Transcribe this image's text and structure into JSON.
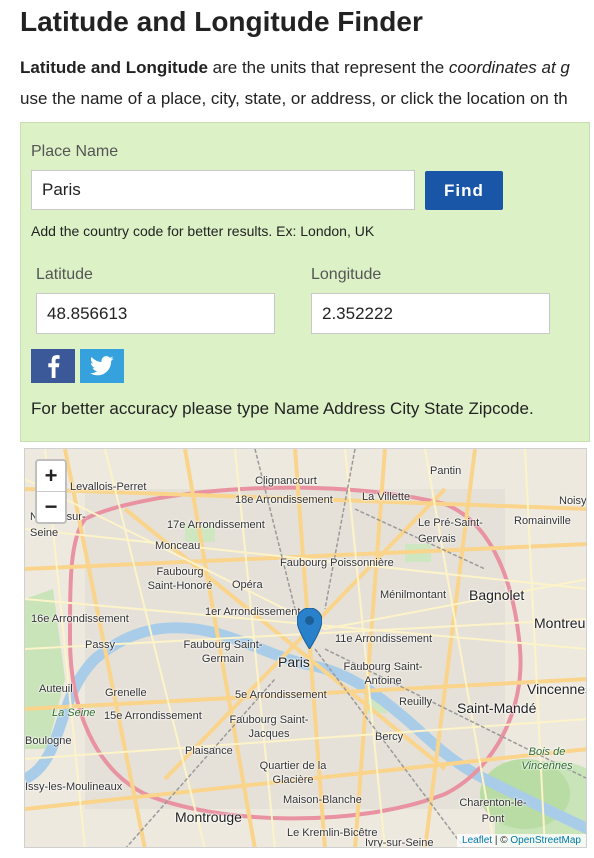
{
  "header": {
    "title": "Latitude and Longitude Finder"
  },
  "intro": {
    "line1_bold": "Latitude and Longitude",
    "line1_rest": " are the units that represent the ",
    "line1_italic": "coordinates at g",
    "line2": "use the name of a place, city, state, or address, or click the location on th"
  },
  "form": {
    "place_label": "Place Name",
    "place_value": "Paris",
    "find_label": "Find",
    "hint": "Add the country code for better results. Ex: London, UK",
    "latitude_label": "Latitude",
    "latitude_value": "48.856613",
    "longitude_label": "Longitude",
    "longitude_value": "2.352222",
    "accuracy_note": "For better accuracy please type Name Address City State Zipcode."
  },
  "social": {
    "facebook_icon": "facebook-icon",
    "twitter_icon": "twitter-icon"
  },
  "map": {
    "zoom_in": "+",
    "zoom_out": "−",
    "attribution_leaflet": "Leaflet",
    "attribution_sep": " | © ",
    "attribution_osm": "OpenStreetMap",
    "places": [
      "Levallois-Perret",
      "Clignancourt",
      "Pantin",
      "18e Arrondissement",
      "La Villette",
      "Noisy",
      "Neuilly-sur-Seine",
      "17e Arrondissement",
      "Le Pré-Saint-Gervais",
      "Romainville",
      "Monceau",
      "Faubourg Poissonnière",
      "Faubourg Saint-Honoré",
      "Opéra",
      "Ménilmontant",
      "Bagnolet",
      "16e Arrondissement",
      "1er Arrondissement",
      "Montreuil",
      "Passy",
      "11e Arrondissement",
      "Faubourg Saint-Germain",
      "Paris",
      "Faubourg Saint-Antoine",
      "Auteuil",
      "Grenelle",
      "5e Arrondissement",
      "Reuilly",
      "Vincennes",
      "La Seine",
      "15e Arrondissement",
      "Faubourg Saint-Jacques",
      "Saint-Mandé",
      "Boulogne",
      "Bercy",
      "Plaisance",
      "Quartier de la Glacière",
      "Bois de Vincennes",
      "Issy-les-Moulineaux",
      "Maison-Blanche",
      "Charenton-le-Pont",
      "Montrouge",
      "Le Kremlin-Bicêtre",
      "Ivry-sur-Seine"
    ]
  },
  "colors": {
    "panel_bg": "#dcf2c6",
    "button": "#1a56a8",
    "facebook": "#3b5998",
    "twitter": "#35a2dd",
    "marker": "#2a81cb"
  }
}
